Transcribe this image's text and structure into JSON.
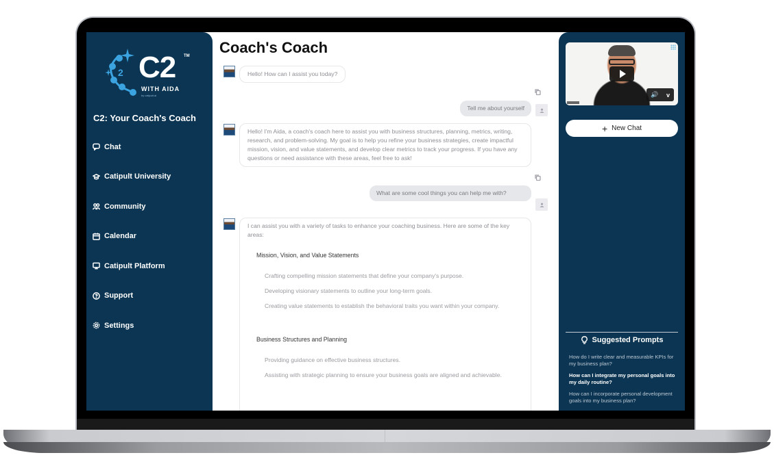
{
  "app": {
    "brand": {
      "logo_text": "C2",
      "logo_trademark": "TM",
      "logo_subtitle": "WITH AIDA",
      "logo_byline": "by catipult.ai",
      "accent_color": "#3ba3e0",
      "sidebar_color": "#0b3552"
    },
    "sidebar": {
      "title": "C2: Your Coach's Coach",
      "items": [
        {
          "label": "Chat",
          "icon": "chat-icon"
        },
        {
          "label": "Catipult University",
          "icon": "graduation-cap-icon"
        },
        {
          "label": "Community",
          "icon": "users-icon"
        },
        {
          "label": "Calendar",
          "icon": "calendar-icon"
        },
        {
          "label": "Catipult Platform",
          "icon": "monitor-icon"
        },
        {
          "label": "Support",
          "icon": "help-circle-icon"
        },
        {
          "label": "Settings",
          "icon": "gear-icon"
        }
      ]
    },
    "main": {
      "title": "Coach's Coach",
      "messages": [
        {
          "role": "assistant",
          "text": "Hello! How can I assist you today?"
        },
        {
          "role": "user",
          "text": "Tell me about yourself"
        },
        {
          "role": "assistant",
          "text": "Hello! I'm Aida, a coach's coach here to assist you with business structures, planning, metrics, writing, research, and problem-solving. My goal is to help you refine your business strategies, create impactful mission, vision, and value statements, and develop clear metrics to track your progress. If you have any questions or need assistance with these areas, feel free to ask!"
        },
        {
          "role": "user",
          "text": "What are some cool things you can help me with?"
        },
        {
          "role": "assistant",
          "intro": "I can assist you with a variety of tasks to enhance your coaching business. Here are some of the key areas:",
          "sections": [
            {
              "heading": "Mission, Vision, and Value Statements",
              "items": [
                "Crafting compelling mission statements that define your company's purpose.",
                "Developing visionary statements to outline your long-term goals.",
                "Creating value statements to establish the behavioral traits you want within your company."
              ]
            },
            {
              "heading": "Business Structures and Planning",
              "items": [
                "Providing guidance on effective business structures.",
                "Assisting with strategic planning to ensure your business goals are aligned and achievable."
              ]
            }
          ]
        }
      ]
    },
    "right_panel": {
      "video": {
        "play_label": "Play",
        "volume_icon": "🔊",
        "vimeo_label": "v"
      },
      "new_chat_label": "New Chat",
      "new_chat_icon": "+",
      "suggested_title": "Suggested Prompts",
      "prompts": [
        {
          "text": "How do I write clear and measurable KPIs for my business plan?",
          "active": false
        },
        {
          "text": "How can I integrate my personal goals into my daily routine?",
          "active": true
        },
        {
          "text": "How can I incorporate personal development goals into my business plan?",
          "active": false
        }
      ]
    }
  }
}
